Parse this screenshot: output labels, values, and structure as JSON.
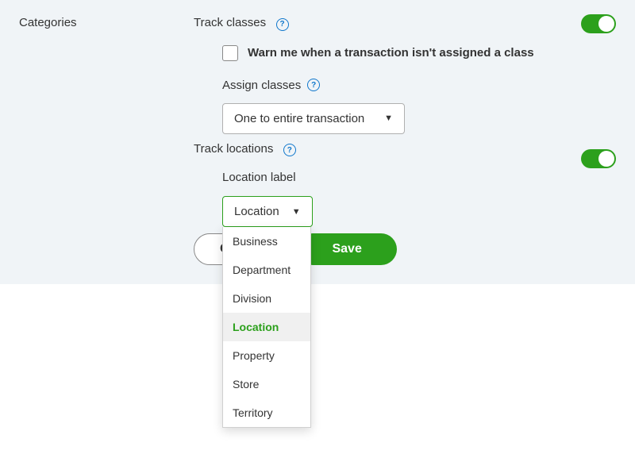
{
  "section": {
    "title": "Categories"
  },
  "trackClasses": {
    "label": "Track classes",
    "warnCheckbox": "Warn me when a transaction isn't assigned a class",
    "assignLabel": "Assign classes",
    "assignSelected": "One to entire transaction"
  },
  "trackLocations": {
    "label": "Track locations",
    "locationLabel": "Location label",
    "selected": "Location",
    "options": [
      "Business",
      "Department",
      "Division",
      "Location",
      "Property",
      "Store",
      "Territory"
    ]
  },
  "buttons": {
    "cancel": "Cancel",
    "save": "Save"
  }
}
